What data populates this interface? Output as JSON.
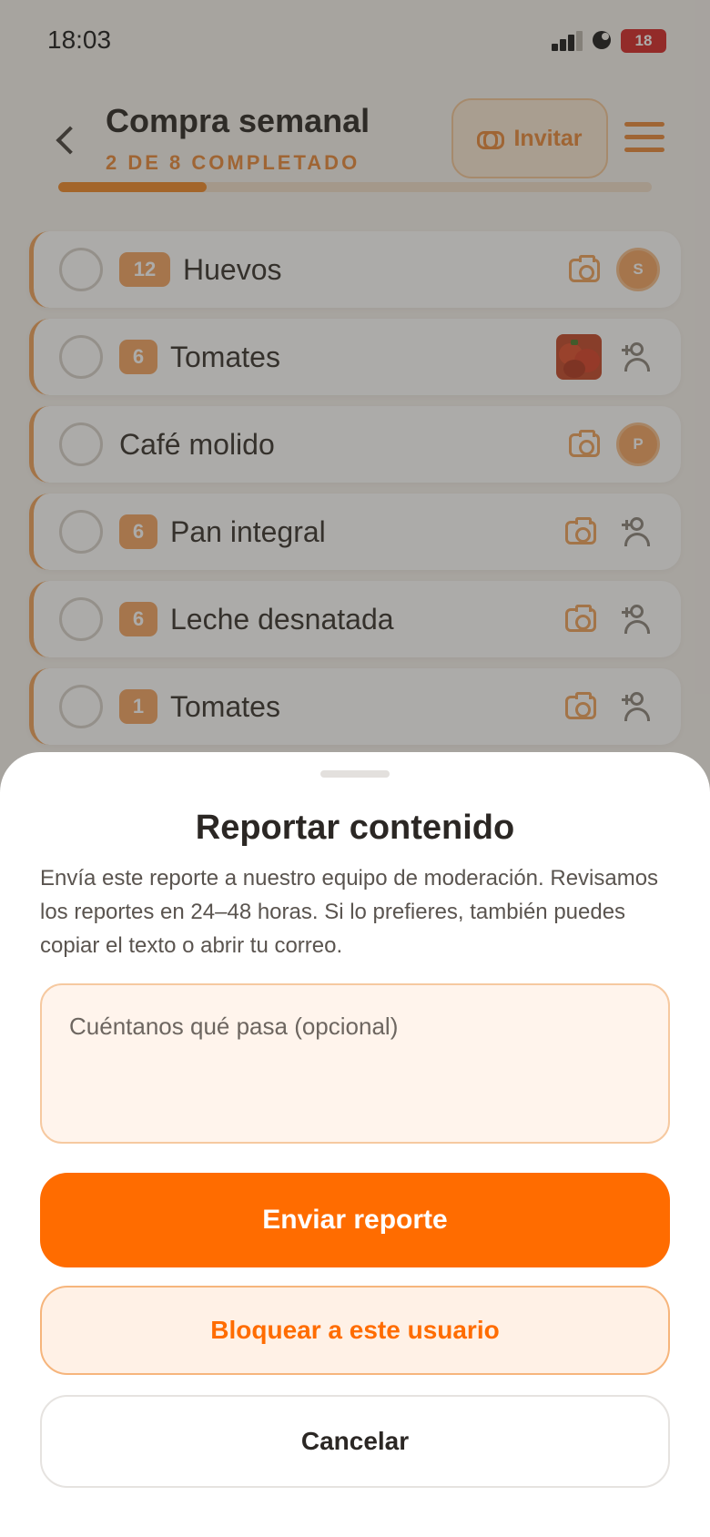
{
  "status_bar": {
    "time": "18:03",
    "battery": "18"
  },
  "header": {
    "title": "Compra semanal",
    "subtitle": "2 DE 8 COMPLETADO",
    "invite_label": "Invitar",
    "progress_fraction": 0.25
  },
  "items": [
    {
      "qty": "12",
      "name": "Huevos",
      "photo": "camera-icon",
      "assignee": "S"
    },
    {
      "qty": "6",
      "name": "Tomates",
      "photo": "tomato-thumbnail",
      "assignee": "add-user-icon"
    },
    {
      "qty": "",
      "name": "Café molido",
      "photo": "camera-icon",
      "assignee": "P"
    },
    {
      "qty": "6",
      "name": "Pan integral",
      "photo": "camera-icon",
      "assignee": "add-user-icon"
    },
    {
      "qty": "6",
      "name": "Leche desnatada",
      "photo": "camera-icon",
      "assignee": "add-user-icon"
    },
    {
      "qty": "1",
      "name": "Tomates",
      "photo": "camera-icon",
      "assignee": "add-user-icon"
    }
  ],
  "sheet": {
    "title": "Reportar contenido",
    "description": "Envía este reporte a nuestro equipo de moderación. Revisamos los reportes en 24–48 horas. Si lo prefieres, también puedes copiar el texto o abrir tu correo.",
    "input_value": "",
    "input_placeholder": "Cuéntanos qué pasa (opcional)",
    "send_label": "Enviar reporte",
    "block_label": "Bloquear a este usuario",
    "cancel_label": "Cancelar"
  },
  "colors": {
    "accent": "#ff6c00",
    "accent_soft": "#f4a564",
    "background": "#f7f3ee",
    "overlay": "rgba(48,44,40,0.40)",
    "battery_low": "#d62a2a"
  }
}
